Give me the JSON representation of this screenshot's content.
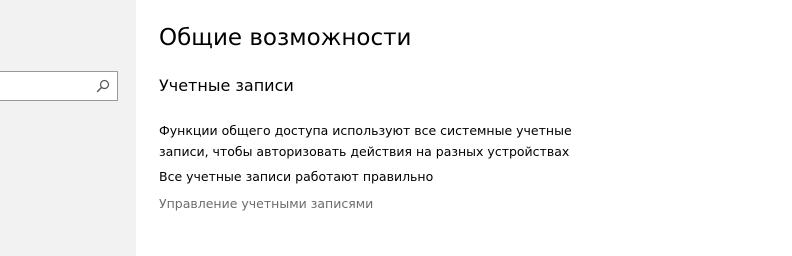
{
  "sidebar": {
    "search": {
      "value": "",
      "icon": "search-icon"
    }
  },
  "main": {
    "title": "Общие возможности",
    "section_heading": "Учетные записи",
    "description_lines": [
      "Функции общего доступа используют все системные учетные",
      "записи, чтобы авторизовать действия на разных устройствах"
    ],
    "status": "Все учетные записи работают правильно",
    "manage_link": "Управление учетными записями"
  },
  "colors": {
    "sidebar_background": "#f2f2f2",
    "link_disabled": "#6d6d6d"
  }
}
